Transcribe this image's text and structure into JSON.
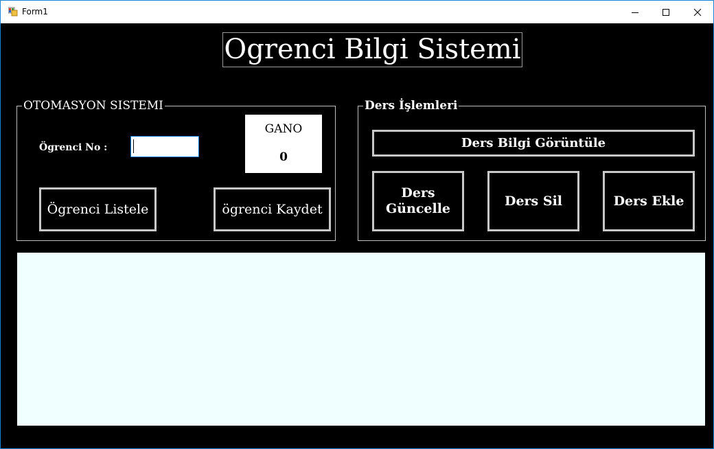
{
  "window": {
    "title": "Form1",
    "icon": "winforms-app-icon",
    "controls": {
      "minimize": "minimize-icon",
      "maximize": "maximize-icon",
      "close": "close-icon"
    }
  },
  "header": {
    "title": "Ogrenci Bilgi Sistemi"
  },
  "student_group": {
    "legend": "OTOMASYON SISTEMI",
    "ogrenci_no_label": "Ögrenci No :",
    "ogrenci_no_value": "",
    "gano_label": "GANO",
    "gano_value": "0",
    "list_button": "Ögrenci Listele",
    "save_button": "ögrenci Kaydet"
  },
  "course_group": {
    "legend": "Ders İşlemleri",
    "view_button": "Ders Bilgi Görüntüle",
    "update_button_line1": "Ders",
    "update_button_line2": "Güncelle",
    "delete_button": "Ders Sil",
    "add_button": "Ders Ekle"
  },
  "colors": {
    "form_background": "#000000",
    "grid_background": "#F0FFFF",
    "button_border": "#C8C8C8",
    "input_focus_border": "#0078D7",
    "window_border": "#1883D7"
  }
}
